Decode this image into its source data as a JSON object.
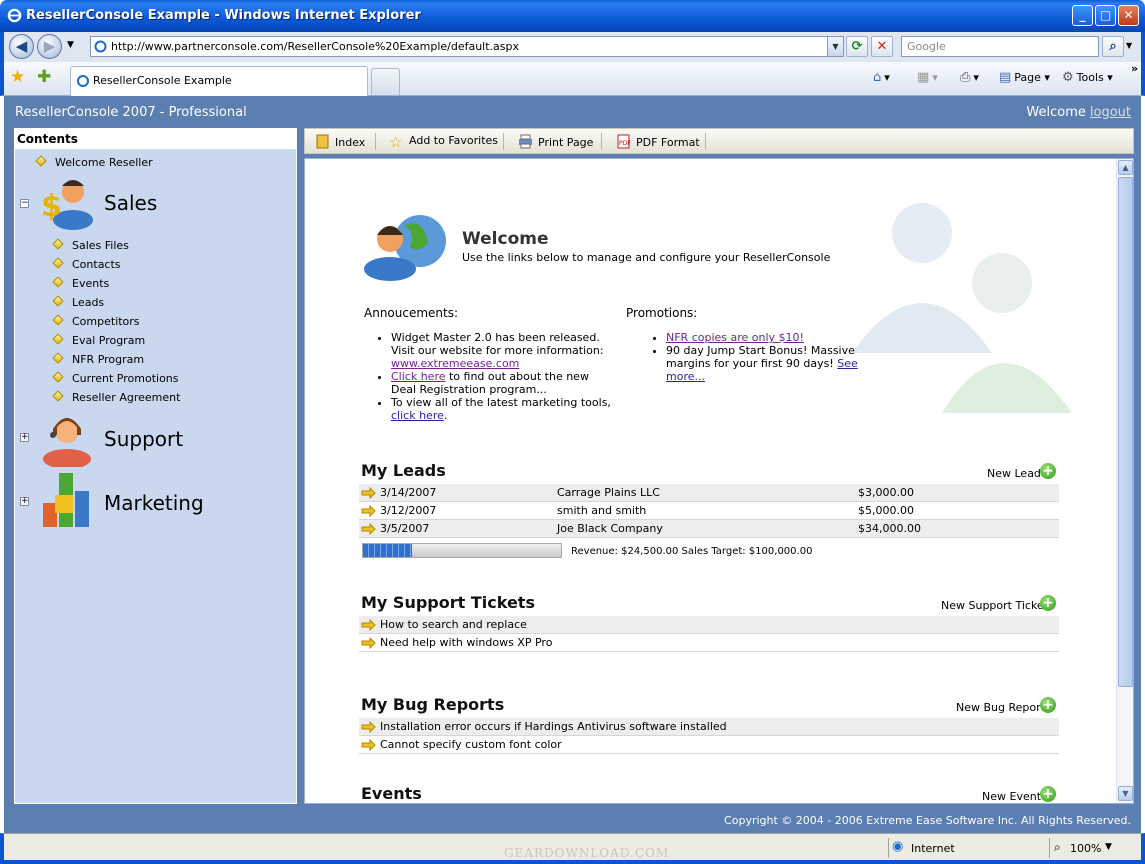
{
  "window": {
    "title": "ResellerConsole Example - Windows Internet Explorer"
  },
  "browser": {
    "address": "http://www.partnerconsole.com/ResellerConsole%20Example/default.aspx",
    "search_placeholder": "Google",
    "tab_label": "ResellerConsole Example",
    "commands": {
      "page": "Page",
      "tools": "Tools"
    },
    "status_zone": "Internet",
    "zoom": "100%",
    "watermark": "GEARDOWNLOAD.COM"
  },
  "app": {
    "title": "ResellerConsole 2007 - Professional",
    "welcome": "Welcome",
    "logout": "logout",
    "footer": "Copyright © 2004 - 2006 Extreme Ease Software Inc. All Rights Reserved."
  },
  "sidebar": {
    "heading": "Contents",
    "welcome_link": "Welcome Reseller",
    "sections": {
      "sales": {
        "title": "Sales",
        "items": [
          "Sales Files",
          "Contacts",
          "Events",
          "Leads",
          "Competitors",
          "Eval Program",
          "NFR Program",
          "Current Promotions",
          "Reseller Agreement"
        ]
      },
      "support": {
        "title": "Support"
      },
      "marketing": {
        "title": "Marketing"
      }
    }
  },
  "toolbar": {
    "index": "Index",
    "favorites": "Add to Favorites",
    "print": "Print Page",
    "pdf": "PDF Format"
  },
  "welcome": {
    "title": "Welcome",
    "subtitle": "Use the links below to manage and configure your ResellerConsole"
  },
  "announcements": {
    "heading": "Annoucements:",
    "item1_text": "Widget Master 2.0 has been released. Visit our website for more information:",
    "item1_link": "www.extremeease.com",
    "item2_link": "Click here",
    "item2_text": " to find out about the new Deal Registration program...",
    "item3_text": "To view all of the latest marketing tools, ",
    "item3_link": "click here",
    "item3_end": "."
  },
  "promotions": {
    "heading": "Promotions:",
    "item1_link": "NFR copies are only $10!",
    "item2_text": "90 day Jump Start Bonus! Massive margins for your first 90 days!",
    "item2_link": "See more..."
  },
  "leads": {
    "title": "My Leads",
    "action": "New Lead",
    "rows": [
      {
        "date": "3/14/2007",
        "company": "Carrage Plains LLC",
        "amount": "$3,000.00"
      },
      {
        "date": "3/12/2007",
        "company": "smith and smith",
        "amount": "$5,000.00"
      },
      {
        "date": "3/5/2007",
        "company": "Joe Black Company",
        "amount": "$34,000.00"
      }
    ],
    "progress": 0.245,
    "revenue_text": "Revenue: $24,500.00 Sales Target: $100,000.00"
  },
  "support_tickets": {
    "title": "My Support Tickets",
    "action": "New Support Ticket",
    "rows": [
      "How to search and replace",
      "Need help with windows XP Pro"
    ]
  },
  "bug_reports": {
    "title": "My Bug Reports",
    "action": "New Bug Report",
    "rows": [
      "Installation error occurs if Hardings Antivirus software installed",
      "Cannot specify custom font color"
    ]
  },
  "events": {
    "title": "Events",
    "action": "New Event"
  },
  "colors": {
    "header_blue": "#5b7fb0",
    "sidebar": "#c9d8ef",
    "link": "#2b1ea8",
    "visited": "#7a1f96",
    "plus_green": "#2c9a13"
  }
}
